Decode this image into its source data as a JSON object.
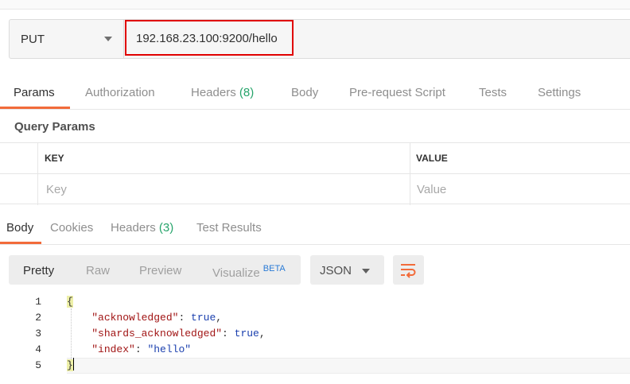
{
  "request": {
    "method": "PUT",
    "url": "192.168.23.100:9200/hello"
  },
  "request_tabs": [
    {
      "label": "Params"
    },
    {
      "label": "Authorization"
    },
    {
      "label": "Headers",
      "count": "(8)"
    },
    {
      "label": "Body"
    },
    {
      "label": "Pre-request Script"
    },
    {
      "label": "Tests"
    },
    {
      "label": "Settings"
    }
  ],
  "query_params": {
    "title": "Query Params",
    "columns": [
      "KEY",
      "VALUE"
    ],
    "key_placeholder": "Key",
    "value_placeholder": "Value"
  },
  "response_tabs": [
    {
      "label": "Body"
    },
    {
      "label": "Cookies"
    },
    {
      "label": "Headers",
      "count": "(3)"
    },
    {
      "label": "Test Results"
    }
  ],
  "view_modes": [
    "Pretty",
    "Raw",
    "Preview",
    "Visualize"
  ],
  "beta_label": "BETA",
  "format": "JSON",
  "icons": {
    "method_dropdown": "chevron-down-icon",
    "format_dropdown": "chevron-down-icon",
    "wrap": "wrap-lines-icon"
  },
  "colors": {
    "accent": "#f26b3a",
    "count": "#26a46b",
    "highlight_box": "#e00000"
  },
  "response_body": {
    "line_numbers": [
      "1",
      "2",
      "3",
      "4",
      "5"
    ],
    "lines": [
      [
        "{"
      ],
      [
        "    ",
        "\"acknowledged\"",
        ": ",
        "true",
        ","
      ],
      [
        "    ",
        "\"shards_acknowledged\"",
        ": ",
        "true",
        ","
      ],
      [
        "    ",
        "\"index\"",
        ": ",
        "\"hello\""
      ],
      [
        "}"
      ]
    ]
  }
}
